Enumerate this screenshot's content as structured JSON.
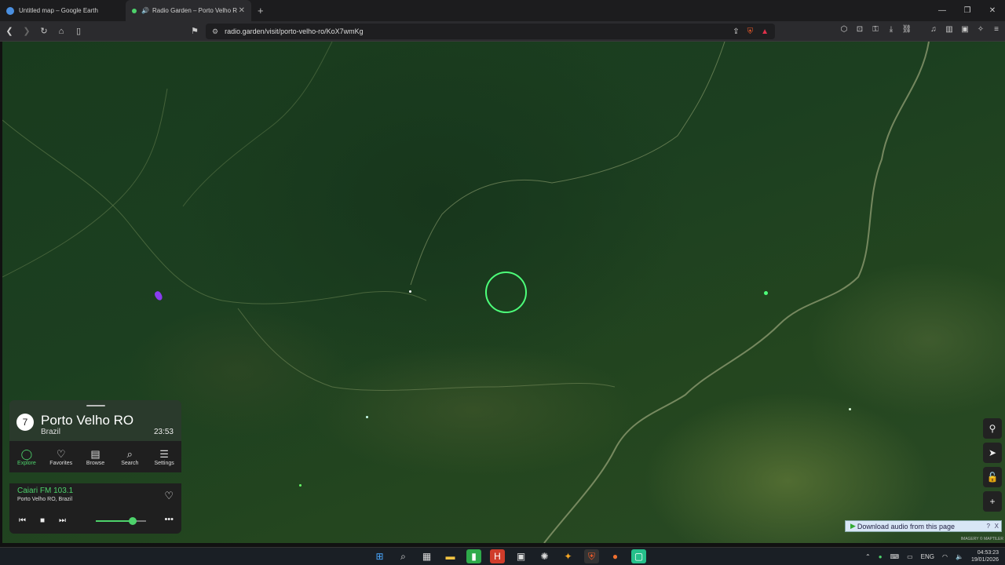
{
  "tabs": [
    {
      "title": "Untitled map – Google Earth",
      "active": false
    },
    {
      "title": "Radio Garden – Porto Velho R",
      "active": true
    }
  ],
  "browser": {
    "url": "radio.garden/visit/porto-velho-ro/KoX7wmKg",
    "shield_count": "3"
  },
  "place": {
    "number": "7",
    "name": "Porto Velho RO",
    "country": "Brazil",
    "time": "23:53"
  },
  "nav": [
    {
      "label": "Explore",
      "icon": "explore-icon",
      "active": true
    },
    {
      "label": "Favorites",
      "icon": "heart-icon",
      "active": false
    },
    {
      "label": "Browse",
      "icon": "map-icon",
      "active": false
    },
    {
      "label": "Search",
      "icon": "search-icon",
      "active": false
    },
    {
      "label": "Settings",
      "icon": "menu-icon",
      "active": false
    }
  ],
  "now_playing": {
    "station": "Caiari FM 103.1",
    "location": "Porto Velho RO, Brazil",
    "volume_fraction": 0.75
  },
  "download_bar": {
    "label": "Download audio from this page",
    "help": "?",
    "close": "X"
  },
  "map_credit": "IMAGERY © MAPTILER",
  "clock": {
    "time": "04:53:23",
    "date": "19/01/2026",
    "lang": "ENG"
  },
  "colors": {
    "accent": "#4dd26b",
    "ring": "#4dff7a"
  }
}
